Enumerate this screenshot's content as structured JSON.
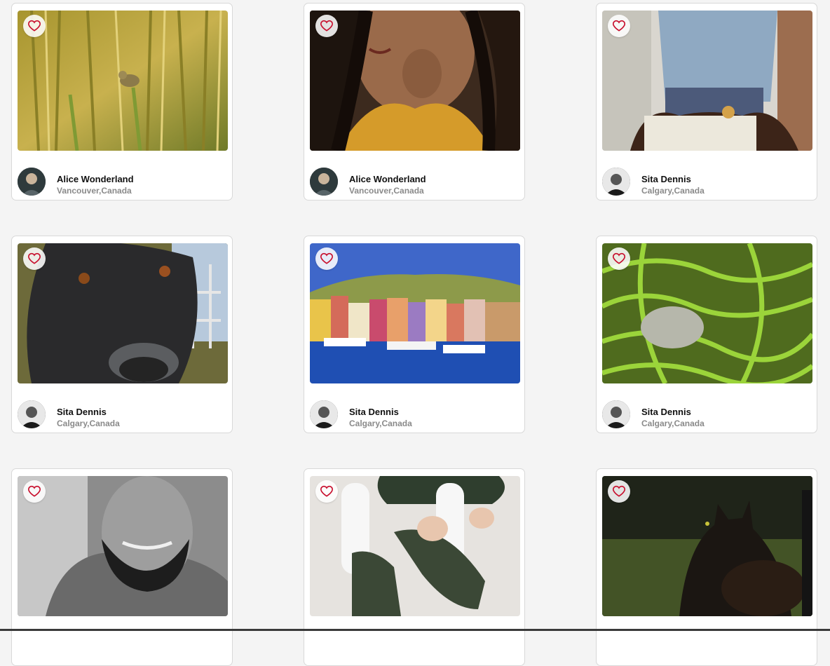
{
  "cards": [
    {
      "photo": "bird-in-reeds",
      "owner": "Alice Wonderland",
      "location": "Vancouver,Canada",
      "avatar": "a"
    },
    {
      "photo": "woman-yellow-sweater",
      "owner": "Alice Wonderland",
      "location": "Vancouver,Canada",
      "avatar": "a"
    },
    {
      "photo": "man-denim-shirt",
      "owner": "Sita Dennis",
      "location": "Calgary,Canada",
      "avatar": "b"
    },
    {
      "photo": "dog-closeup",
      "owner": "Sita Dennis",
      "location": "Calgary,Canada",
      "avatar": "b"
    },
    {
      "photo": "colorful-harbor",
      "owner": "Sita Dennis",
      "location": "Calgary,Canada",
      "avatar": "b"
    },
    {
      "photo": "rice-terraces",
      "owner": "Sita Dennis",
      "location": "Calgary,Canada",
      "avatar": "b"
    },
    {
      "photo": "bearded-man-bw",
      "owner": "",
      "location": "",
      "avatar": ""
    },
    {
      "photo": "green-sandals",
      "owner": "",
      "location": "",
      "avatar": ""
    },
    {
      "photo": "black-cat",
      "owner": "",
      "location": "",
      "avatar": ""
    }
  ],
  "icons": {
    "like": "heart-outline-icon"
  },
  "colors": {
    "heart": "#c8102e",
    "background": "#f4f4f4",
    "location_text": "#8a8a8a"
  }
}
